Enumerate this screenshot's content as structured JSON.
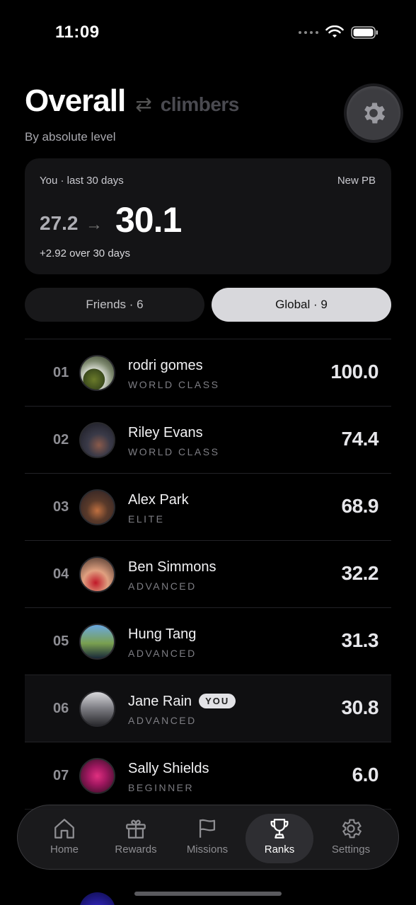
{
  "status": {
    "time": "11:09"
  },
  "header": {
    "title": "Overall",
    "alt_title": "climbers",
    "subtitle": "By absolute level"
  },
  "card": {
    "label": "You · last 30 days",
    "badge": "New PB",
    "from": "27.2",
    "to": "30.1",
    "delta": "+2.92 over 30 days"
  },
  "segments": {
    "friends": "Friends · 6",
    "global": "Global · 9",
    "selected": "global"
  },
  "leaderboard": [
    {
      "rank": "01",
      "name": "rodri gomes",
      "tier": "WORLD CLASS",
      "score": "100.0"
    },
    {
      "rank": "02",
      "name": "Riley Evans",
      "tier": "WORLD CLASS",
      "score": "74.4"
    },
    {
      "rank": "03",
      "name": "Alex Park",
      "tier": "ELITE",
      "score": "68.9"
    },
    {
      "rank": "04",
      "name": "Ben Simmons",
      "tier": "ADVANCED",
      "score": "32.2"
    },
    {
      "rank": "05",
      "name": "Hung Tang",
      "tier": "ADVANCED",
      "score": "31.3"
    },
    {
      "rank": "06",
      "name": "Jane Rain",
      "tier": "ADVANCED",
      "score": "30.8",
      "you": "YOU"
    },
    {
      "rank": "07",
      "name": "Sally Shields",
      "tier": "BEGINNER",
      "score": "6.0"
    }
  ],
  "tabs": [
    {
      "label": "Home",
      "icon": "home-icon"
    },
    {
      "label": "Rewards",
      "icon": "gift-icon"
    },
    {
      "label": "Missions",
      "icon": "flag-icon"
    },
    {
      "label": "Ranks",
      "icon": "trophy-icon",
      "active": true
    },
    {
      "label": "Settings",
      "icon": "gear-icon"
    }
  ],
  "colors": {
    "background": "#000000",
    "card": "#141416",
    "selected_segment": "#d8d8dc"
  }
}
